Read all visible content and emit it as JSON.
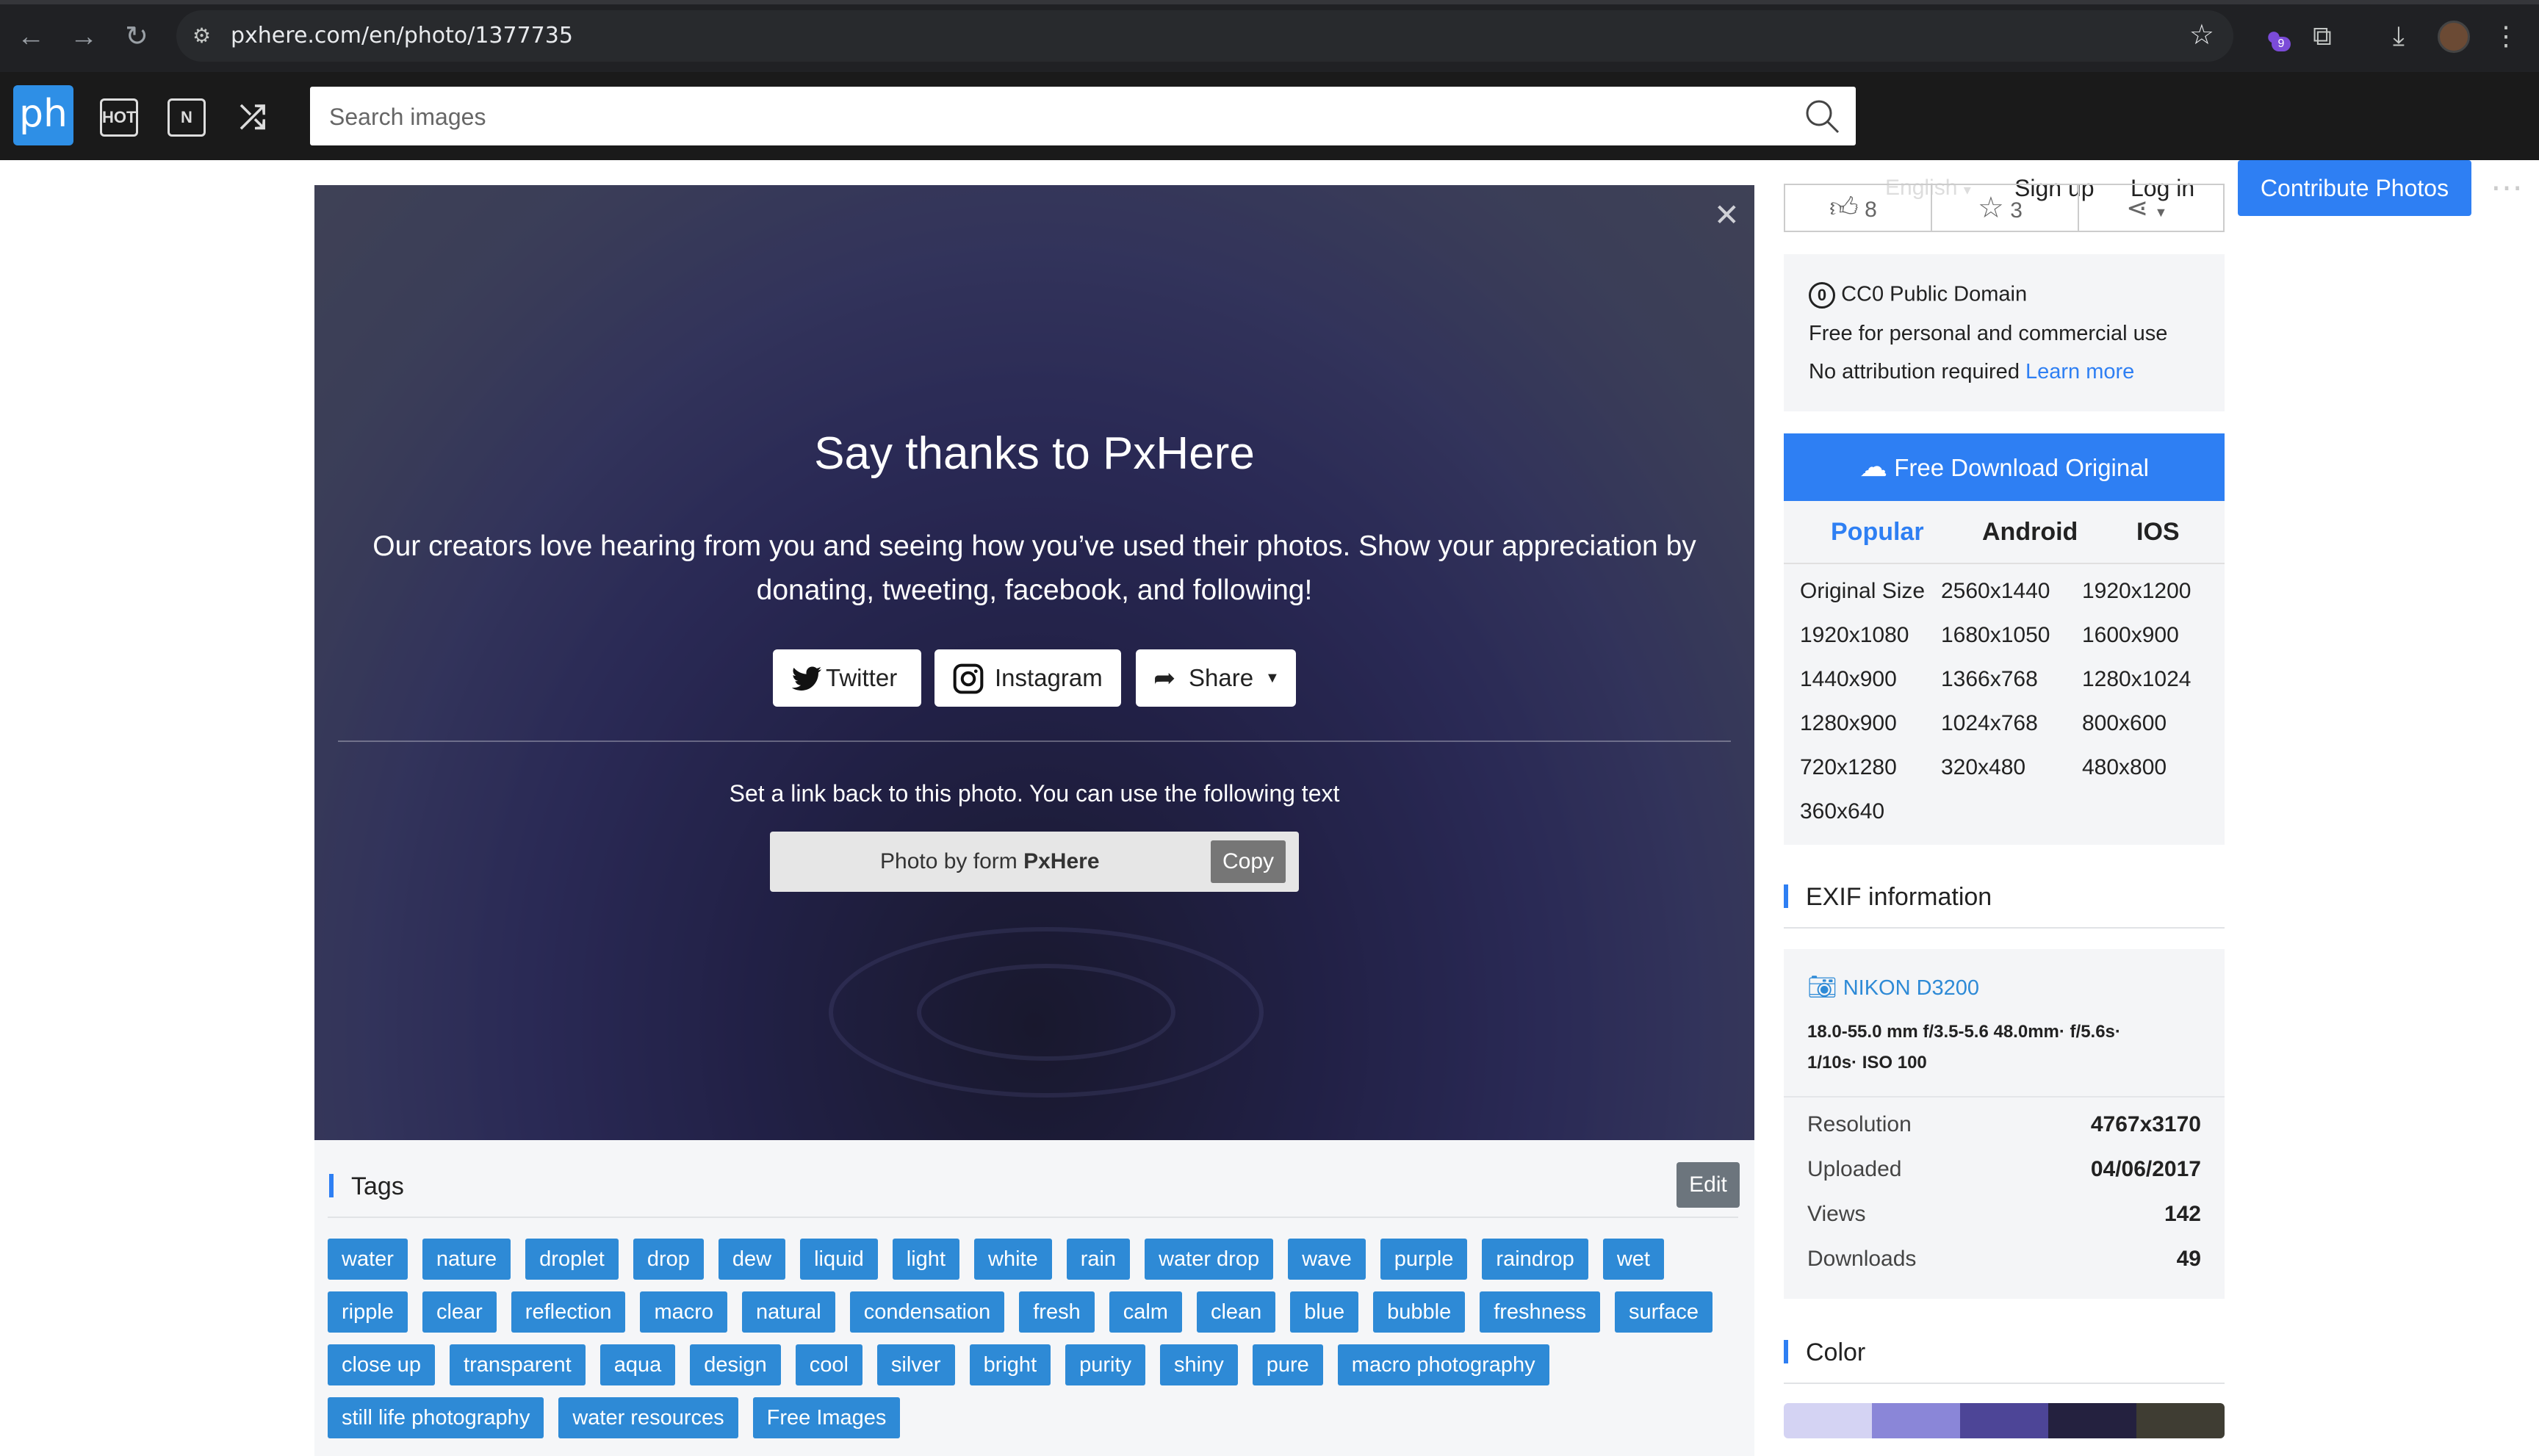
{
  "browser": {
    "url": "pxhere.com/en/photo/1377735",
    "ext_badge": "9"
  },
  "header": {
    "logo": "ph",
    "hot_icon_text": "HOT",
    "new_icon_text": "N",
    "search_placeholder": "Search images",
    "language": "English",
    "sign_up": "Sign up",
    "log_in": "Log in",
    "contribute": "Contribute Photos"
  },
  "modal": {
    "title": "Say thanks to PxHere",
    "text": "Our creators love hearing from you and seeing how you’ve used their photos. Show your appreciation by donating, tweeting, facebook, and following!",
    "twitter": "Twitter",
    "instagram": "Instagram",
    "share": "Share",
    "linkback": "Set a link back to this photo. You can use the following text",
    "credit_prefix": "Photo by form ",
    "credit_brand": "PxHere",
    "copy": "Copy"
  },
  "tags": {
    "title": "Tags",
    "edit": "Edit",
    "items": [
      "water",
      "nature",
      "droplet",
      "drop",
      "dew",
      "liquid",
      "light",
      "white",
      "rain",
      "water drop",
      "wave",
      "purple",
      "raindrop",
      "wet",
      "ripple",
      "clear",
      "reflection",
      "macro",
      "natural",
      "condensation",
      "fresh",
      "calm",
      "clean",
      "blue",
      "bubble",
      "freshness",
      "surface",
      "close up",
      "transparent",
      "aqua",
      "design",
      "cool",
      "silver",
      "bright",
      "purity",
      "shiny",
      "pure",
      "macro photography",
      "still life photography",
      "water resources",
      "Free Images"
    ]
  },
  "actions": {
    "likes": "8",
    "favorites": "3"
  },
  "license": {
    "title": "CC0 Public Domain",
    "line1": "Free for personal and commercial use",
    "line2": "No attribution required ",
    "learn_more": "Learn more"
  },
  "download": {
    "button": "Free Download Original",
    "tabs": [
      "Popular",
      "Android",
      "IOS"
    ],
    "sizes": [
      "Original Size",
      "2560x1440",
      "1920x1200",
      "1920x1080",
      "1680x1050",
      "1600x900",
      "1440x900",
      "1366x768",
      "1280x1024",
      "1280x900",
      "1024x768",
      "800x600",
      "720x1280",
      "320x480",
      "480x800",
      "360x640"
    ]
  },
  "exif": {
    "title": "EXIF information",
    "camera": "NIKON D3200",
    "spec_line1": "18.0-55.0 mm f/3.5-5.6 48.0mm· f/5.6s·",
    "spec_line2": "1/10s· ISO 100",
    "rows": [
      {
        "label": "Resolution",
        "value": "4767x3170"
      },
      {
        "label": "Uploaded",
        "value": "04/06/2017"
      },
      {
        "label": "Views",
        "value": "142"
      },
      {
        "label": "Downloads",
        "value": "49"
      }
    ]
  },
  "color": {
    "title": "Color",
    "swatches": [
      "#d4d3f3",
      "#8a86d8",
      "#4d4597",
      "#24213f",
      "#3f3d33"
    ]
  }
}
